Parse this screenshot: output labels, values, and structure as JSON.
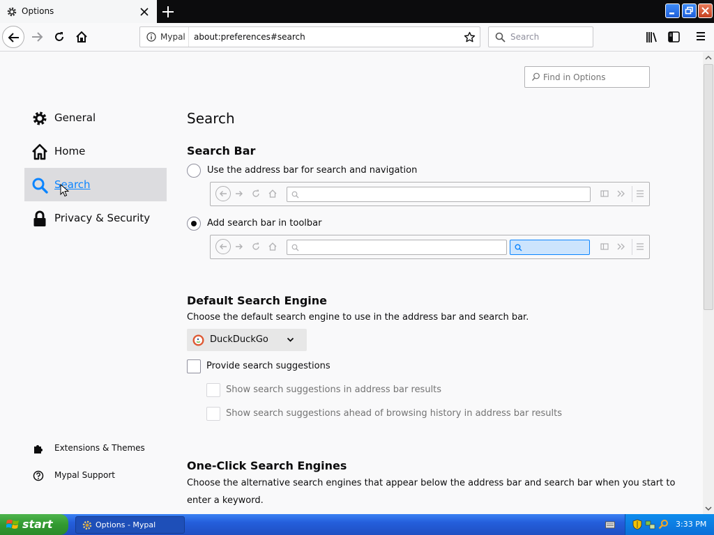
{
  "tab": {
    "title": "Options"
  },
  "toolbar": {
    "identity_label": "Mypal",
    "url": "about:preferences#search",
    "search_placeholder": "Search"
  },
  "content": {
    "find_placeholder": "Find in Options",
    "categories": [
      {
        "label": "General"
      },
      {
        "label": "Home"
      },
      {
        "label": "Search"
      },
      {
        "label": "Privacy & Security"
      }
    ],
    "footer_links": [
      {
        "label": "Extensions & Themes"
      },
      {
        "label": "Mypal Support"
      }
    ],
    "page_title": "Search",
    "search_bar": {
      "heading": "Search Bar",
      "option_address_bar": "Use the address bar for search and navigation",
      "option_toolbar": "Add search bar in toolbar",
      "selected": "toolbar"
    },
    "default_engine": {
      "heading": "Default Search Engine",
      "description": "Choose the default search engine to use in the address bar and search bar.",
      "selected_engine": "DuckDuckGo",
      "provide_suggestions": "Provide search suggestions",
      "show_in_address_bar": "Show search suggestions in address bar results",
      "show_ahead_of_history": "Show search suggestions ahead of browsing history in address bar results"
    },
    "one_click": {
      "heading": "One-Click Search Engines",
      "description_line1": "Choose the alternative search engines that appear below the address bar and search bar when you start to",
      "description_line2": "enter a keyword."
    }
  },
  "taskbar": {
    "start_label": "start",
    "window_label": "Options - Mypal",
    "clock": "3:33 PM"
  },
  "colors": {
    "accent": "#0a84ff",
    "selected_category_bg": "#dcdcdf",
    "taskbar_blue": "#245edb",
    "start_green": "#329a31"
  }
}
